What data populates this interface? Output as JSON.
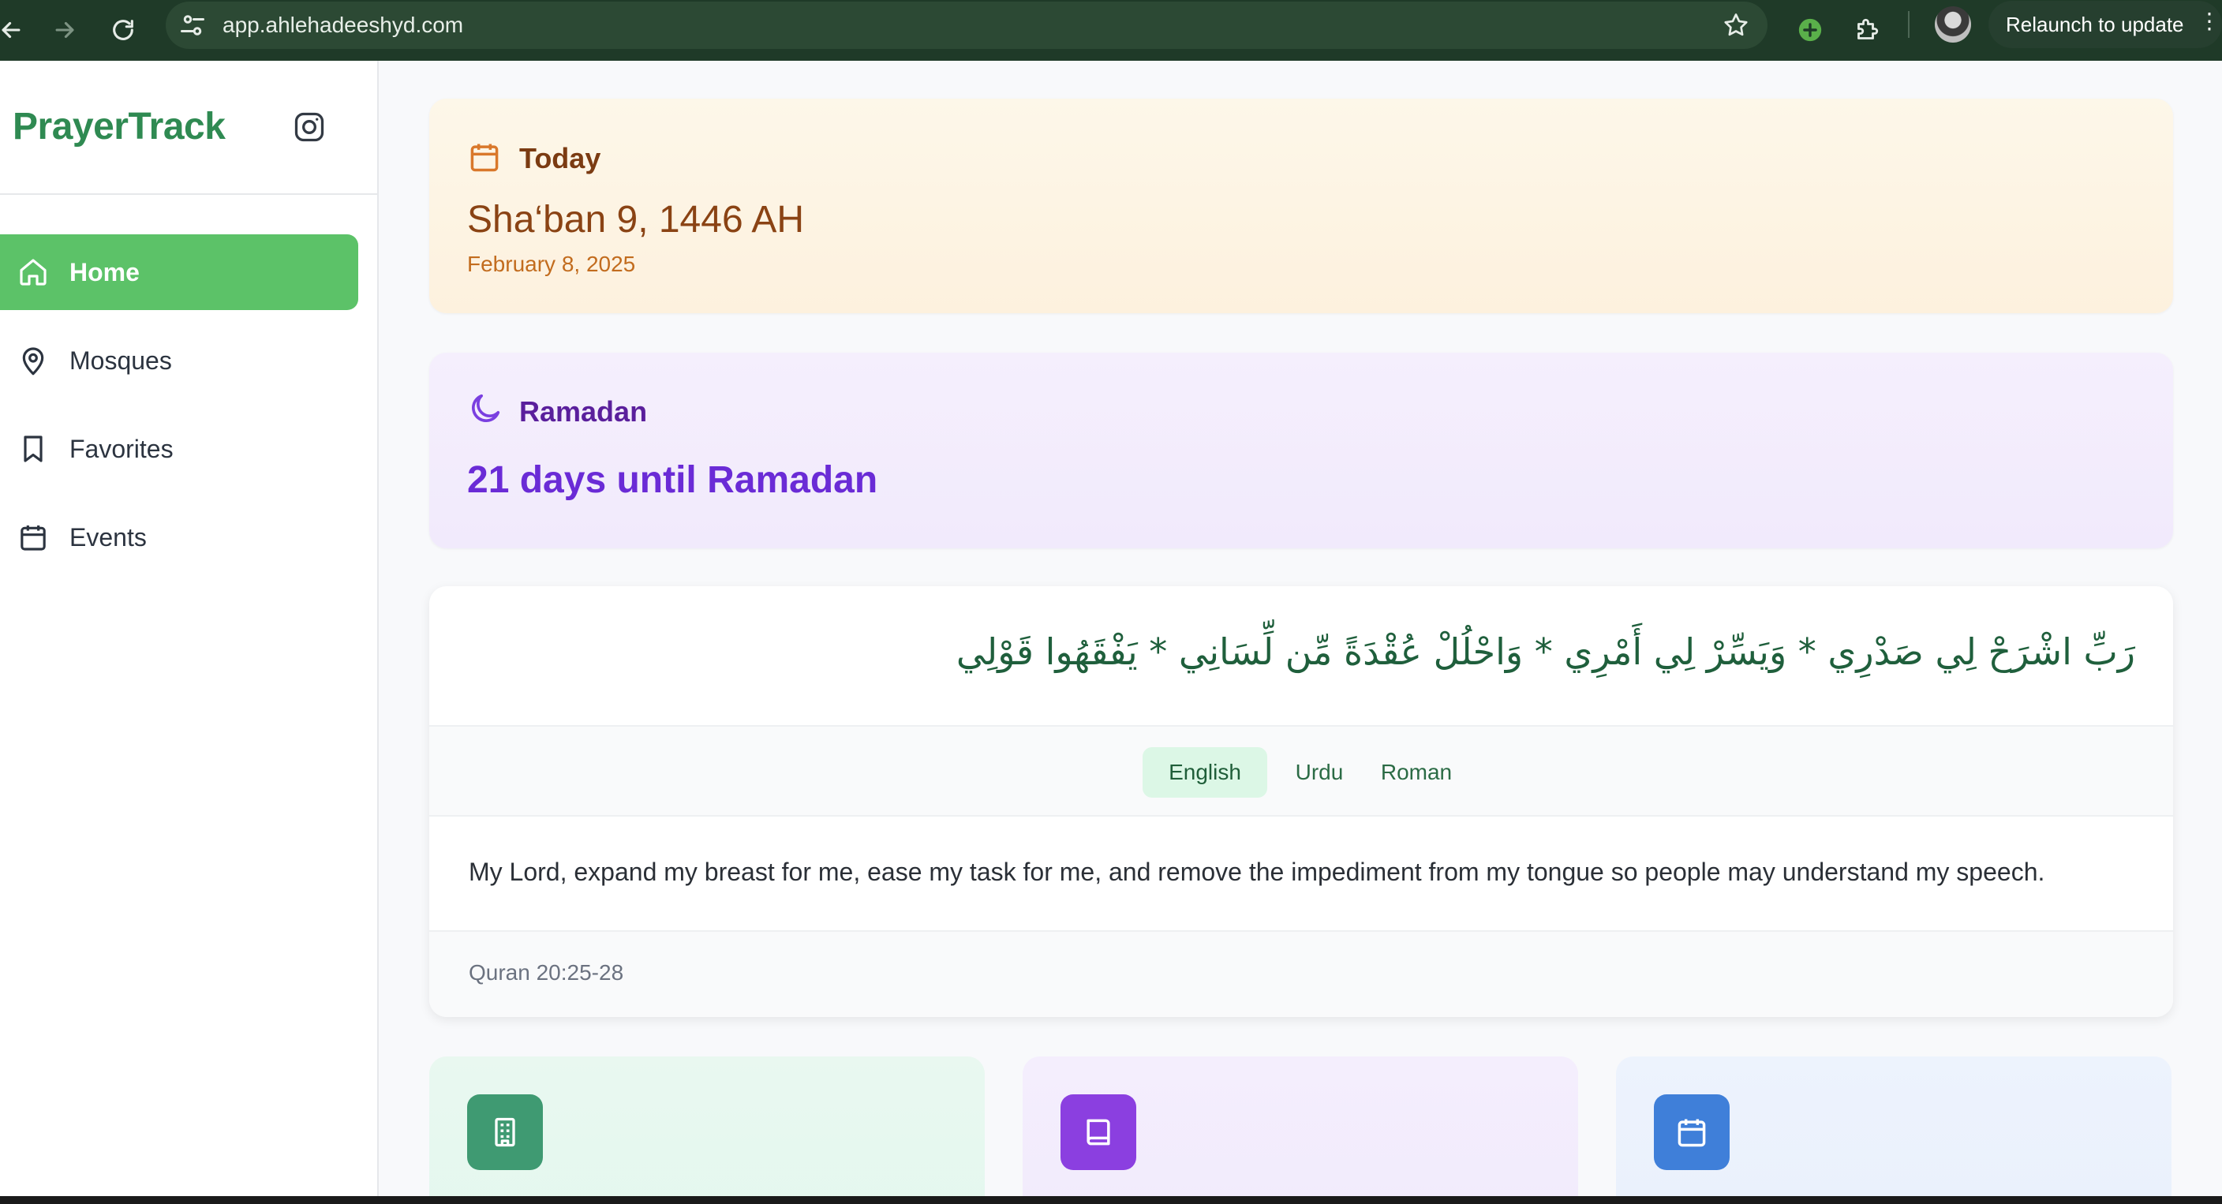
{
  "browser": {
    "url": "app.ahlehadeeshyd.com",
    "relaunch_label": "Relaunch to update",
    "menu_glyph": "⋮"
  },
  "sidebar": {
    "brand": "PrayerTrack",
    "items": [
      {
        "label": "Home",
        "icon": "home-icon",
        "active": true
      },
      {
        "label": "Mosques",
        "icon": "map-pin-icon",
        "active": false
      },
      {
        "label": "Favorites",
        "icon": "bookmark-icon",
        "active": false
      },
      {
        "label": "Events",
        "icon": "calendar-icon",
        "active": false
      }
    ]
  },
  "today": {
    "title": "Today",
    "hijri": "Sha‘ban 9, 1446 AH",
    "gregorian": "February 8, 2025"
  },
  "ramadan": {
    "title": "Ramadan",
    "countdown": "21 days until Ramadan"
  },
  "dua": {
    "arabic": "رَبِّ اشْرَحْ لِي صَدْرِي * وَيَسِّرْ لِي أَمْرِي * وَاحْلُلْ عُقْدَةً مِّن لِّسَانِي * يَفْقَهُوا قَوْلِي",
    "tabs": [
      "English",
      "Urdu",
      "Roman"
    ],
    "active_tab": "English",
    "translation": "My Lord, expand my breast for me, ease my task for me, and remove the impediment from my tongue so people may understand my speech.",
    "reference": "Quran 20:25-28"
  },
  "features": [
    {
      "icon": "mosque-building-icon",
      "color": "#3f9a72"
    },
    {
      "icon": "book-icon",
      "color": "#8b3fe0"
    },
    {
      "icon": "calendar-icon",
      "color": "#3f7fd9"
    }
  ],
  "colors": {
    "brand_green": "#2f8a52",
    "active_nav": "#5cc268",
    "today_accent": "#8a4314",
    "ramadan_accent": "#6a2bd6"
  }
}
